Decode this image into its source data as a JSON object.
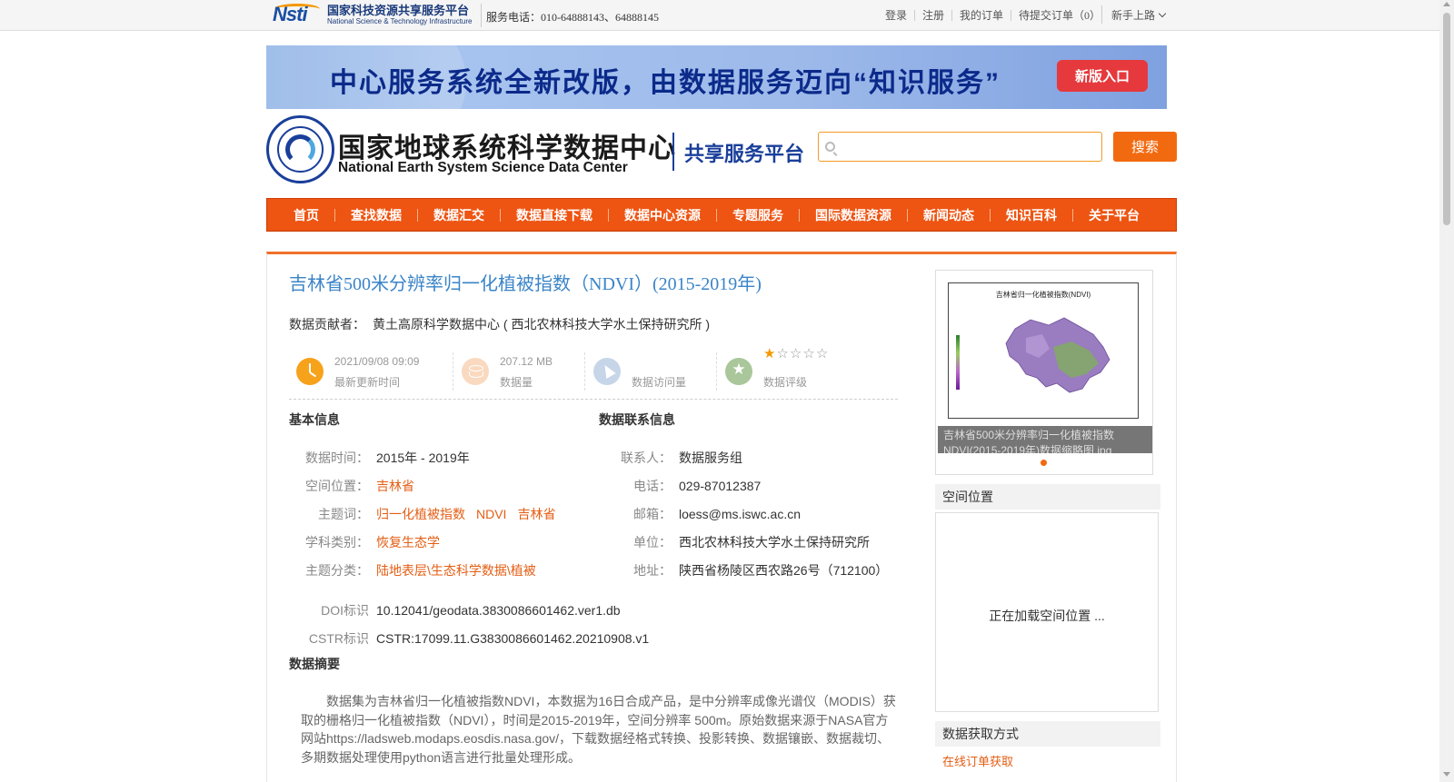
{
  "topbar": {
    "nsti_cn": "国家科技资源共享服务平台",
    "nsti_en": "National Science & Technology Infrastructure",
    "phone": "服务电话：010-64888143、64888145",
    "links": [
      "登录",
      "注册",
      "我的订单",
      "待提交订单（0）"
    ],
    "newbie": "新手上路"
  },
  "banner": {
    "text": "中心服务系统全新改版，由数据服务迈向“知识服务”",
    "button": "新版入口"
  },
  "header": {
    "center_cn": "国家地球系统科学数据中心",
    "center_en": "National Earth System Science Data Center",
    "platform": "共享服务平台",
    "search_placeholder": "",
    "search_button": "搜索"
  },
  "nav": [
    "首页",
    "查找数据",
    "数据汇交",
    "数据直接下载",
    "数据中心资源",
    "专题服务",
    "国际数据资源",
    "新闻动态",
    "知识百科",
    "关于平台"
  ],
  "dataset": {
    "title": "吉林省500米分辨率归一化植被指数（NDVI）(2015-2019年)",
    "contributor_label": "数据贡献者：",
    "contributor": "黄土高原科学数据中心 ( 西北农林科技大学水土保持研究所 )"
  },
  "stats": {
    "update_time": "2021/09/08 09:09",
    "update_label": "最新更新时间",
    "size": "207.12 MB",
    "size_label": "数据量",
    "visits": "",
    "visits_label": "数据访问量",
    "rating": 1,
    "rating_max": 5,
    "rating_label": "数据评级"
  },
  "basic": {
    "heading": "基本信息",
    "rows": [
      {
        "key": "数据时间：",
        "value": "2015年 - 2019年"
      },
      {
        "key": "空间位置：",
        "value": "吉林省"
      },
      {
        "key": "主题词：",
        "keywords": [
          "归一化植被指数",
          "NDVI",
          "吉林省"
        ]
      },
      {
        "key": "学科类别：",
        "value": "恢复生态学"
      },
      {
        "key": "主题分类：",
        "value": "陆地表层\\生态科学数据\\植被"
      }
    ],
    "doi_label": "DOI标识",
    "doi": "10.12041/geodata.3830086601462.ver1.db",
    "cstr_label": "CSTR标识",
    "cstr": "CSTR:17099.11.G3830086601462.20210908.v1"
  },
  "contact": {
    "heading": "数据联系信息",
    "rows": [
      {
        "key": "联系人：",
        "value": "数据服务组"
      },
      {
        "key": "电话：",
        "value": "029-87012387"
      },
      {
        "key": "邮箱：",
        "value": "loess@ms.iswc.ac.cn"
      },
      {
        "key": "单位：",
        "value": "西北农林科技大学水土保持研究所"
      },
      {
        "key": "地址：",
        "value": "陕西省杨陵区西农路26号（712100）"
      }
    ]
  },
  "abstract": {
    "heading": "数据摘要",
    "text": "数据集为吉林省归一化植被指数NDVI，本数据为16日合成产品，是中分辨率成像光谱仪（MODIS）获取的栅格归一化植被指数（NDVI），时间是2015-2019年，空间分辨率 500m。原始数据来源于NASA官方网站https://ladsweb.modaps.eosdis.nasa.gov/，下载数据经格式转换、投影转换、数据镶嵌、数据裁切、多期数据处理使用python语言进行批量处理形成。"
  },
  "sidebar": {
    "thumb_map_title": "吉林省归一化植被指数(NDVI)",
    "thumb_caption": "吉林省500米分辨率归一化植被指数NDVI(2015-2019年)数据缩略图.jpg",
    "spatial_heading": "空间位置",
    "spatial_loading": "正在加载空间位置 ...",
    "access_heading": "数据获取方式",
    "order_link": "在线订单获取"
  },
  "colors": {
    "accent_orange": "#ee5412",
    "title_blue": "#3a84c8",
    "link_orange": "#e45e14"
  }
}
